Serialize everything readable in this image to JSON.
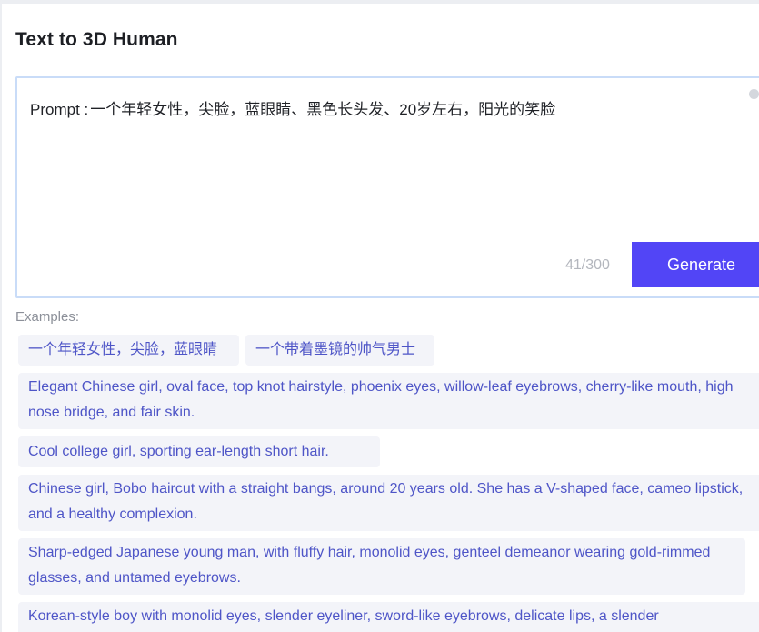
{
  "title": "Text to 3D Human",
  "prompt": {
    "label": "Prompt :",
    "value": "一个年轻女性，尖脸，蓝眼睛、黑色长头发、20岁左右，阳光的笑脸",
    "counter": "41/300"
  },
  "generate_label": "Generate",
  "examples_label": "Examples:",
  "examples": [
    "一个年轻女性，尖脸，蓝眼睛",
    "一个带着墨镜的帅气男士",
    "Elegant Chinese girl, oval face, top knot hairstyle, phoenix eyes, willow-leaf eyebrows, cherry-like mouth, high nose bridge, and fair skin.",
    "Cool college girl, sporting ear-length short hair.",
    "Chinese girl, Bobo haircut with a straight bangs, around 20 years old. She has a V-shaped face, cameo lipstick, and a healthy complexion.",
    "Sharp-edged Japanese young man, with fluffy hair, monolid eyes, genteel demeanor wearing gold-rimmed glasses, and untamed eyebrows.",
    "Korean-style boy with monolid eyes, slender eyeliner, sword-like eyebrows, delicate lips, a slender"
  ],
  "colors": {
    "accent": "#5245f6",
    "example_text": "#4e55c7",
    "example_bg": "#f3f4f9",
    "box_border": "#c9dcf8"
  }
}
